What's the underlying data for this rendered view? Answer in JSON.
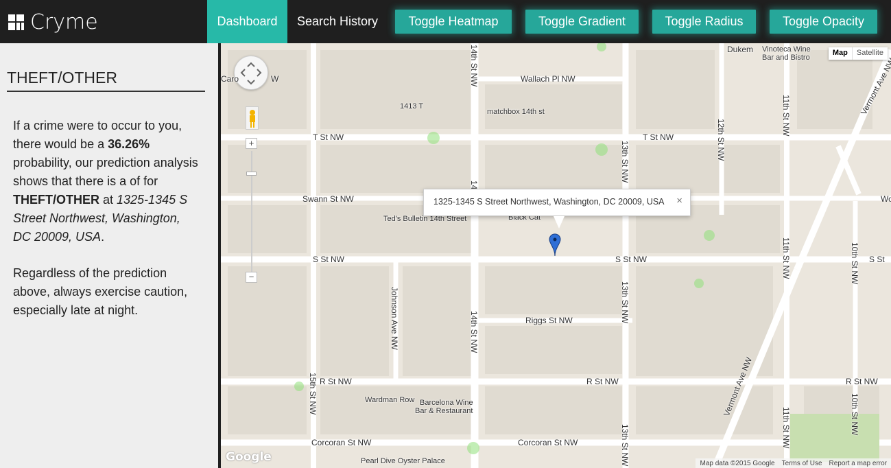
{
  "app": {
    "name": "Cryme",
    "icon": "grid-logo-icon"
  },
  "nav": {
    "dashboard": "Dashboard",
    "search_history": "Search History"
  },
  "toolbar": {
    "heatmap": "Toggle Heatmap",
    "gradient": "Toggle Gradient",
    "radius": "Toggle Radius",
    "opacity": "Toggle Opacity"
  },
  "sidebar": {
    "title": "THEFT/OTHER",
    "p1": "If a crime were to occur to you, there would be a ",
    "probability": "36.26%",
    "p2": " probability, our prediction analysis shows that there is a of for ",
    "crime": "THEFT/OTHER",
    "p3": " at ",
    "address": "1325-1345 S Street Northwest, Washington, DC 20009, USA",
    "p4": ".",
    "note": "Regardless of the prediction above, always exercise caution, especially late at night."
  },
  "map": {
    "type_map": "Map",
    "type_satellite": "Satellite",
    "info_address": "1325-1345 S Street Northwest, Washington, DC 20009, USA",
    "info_close": "×",
    "zoom_in": "+",
    "zoom_out": "−",
    "logo": "Google",
    "attribution": {
      "data": "Map data ©2015 Google",
      "terms": "Terms of Use",
      "report": "Report a map error"
    },
    "labels": {
      "dukem": "Dukem",
      "vinoteca1": "Vinoteca Wine",
      "vinoteca2": "Bar and Bistro",
      "caro": "Caro",
      "nw_frag": "W",
      "wallach": "Wallach Pl NW",
      "n1413": "1413 T",
      "matchbox": "matchbox 14th st",
      "t_st_w": "T St NW",
      "t_st_e": "T St NW",
      "swann": "Swann St NW",
      "wo_frag": "Wo",
      "teds": "Ted's Bulletin 14th Street",
      "blackcat": "Black Cat",
      "s_st_w": "S St NW",
      "s_st_mid": "S St NW",
      "s_st_e": "S St",
      "riggs": "Riggs St NW",
      "r_st_w": "R St NW",
      "r_st_mid": "R St NW",
      "r_st_e": "R St NW",
      "wardman": "Wardman Row",
      "barcelona1": "Barcelona Wine",
      "barcelona2": "Bar & Restaurant",
      "corcoran_w": "Corcoran St NW",
      "corcoran_e": "Corcoran St NW",
      "pearl": "Pearl Dive Oyster Palace",
      "st14_top": "14th St NW",
      "st14_mid": "14th St NW",
      "st14_frag": "14",
      "st13_top": "13th St NW",
      "st13_mid": "13th St NW",
      "st13_bot": "13th St NW",
      "st12": "12th St NW",
      "st11_top": "11th St NW",
      "st11_mid": "11th St NW",
      "st11_bot": "11th St NW",
      "st10_mid": "10th St NW",
      "st10_bot": "10th St NW",
      "st15": "15th St NW",
      "johnson": "Johnson Ave NW",
      "vermont_top": "Vermont Ave NW",
      "vermont_bot": "Vermont Ave NW"
    }
  }
}
